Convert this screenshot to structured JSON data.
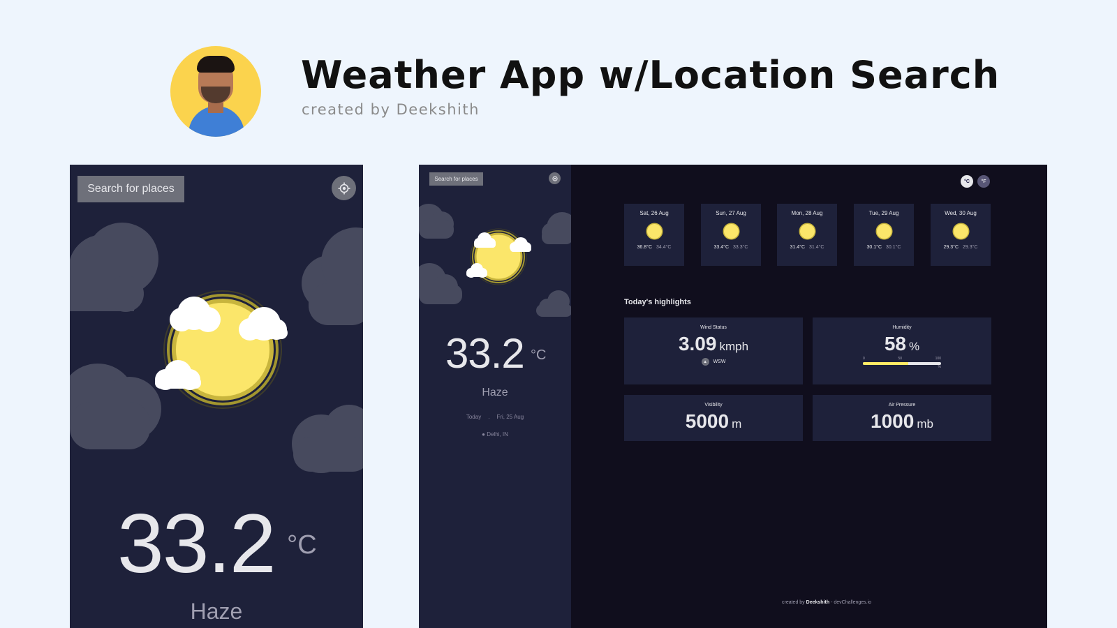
{
  "header": {
    "title": "Weather App w/Location Search",
    "subtitle": "created by Deekshith"
  },
  "mobile": {
    "search_label": "Search for places",
    "temperature": "33.2",
    "unit": "°C",
    "condition": "Haze"
  },
  "desktop": {
    "search_label": "Search for places",
    "temperature": "33.2",
    "unit": "°C",
    "condition": "Haze",
    "today_label": "Today",
    "date_sep": ".",
    "date": "Fri, 25 Aug",
    "location": "Delhi, IN",
    "unit_c": "°C",
    "unit_f": "°F",
    "forecast": [
      {
        "day": "Sat, 26 Aug",
        "max": "36.8°C",
        "min": "34.4°C"
      },
      {
        "day": "Sun, 27 Aug",
        "max": "33.4°C",
        "min": "33.3°C"
      },
      {
        "day": "Mon, 28 Aug",
        "max": "31.4°C",
        "min": "31.4°C"
      },
      {
        "day": "Tue, 29 Aug",
        "max": "30.1°C",
        "min": "30.1°C"
      },
      {
        "day": "Wed, 30 Aug",
        "max": "29.3°C",
        "min": "29.3°C"
      }
    ],
    "highlights_title": "Today's highlights",
    "wind": {
      "label": "Wind Status",
      "value": "3.09",
      "unit": "kmph",
      "direction": "WSW"
    },
    "humidity": {
      "label": "Humidity",
      "value": "58",
      "unit": "%",
      "tick_0": "0",
      "tick_50": "50",
      "tick_100": "100",
      "pct": "%",
      "level": 0.58
    },
    "visibility": {
      "label": "Visibility",
      "value": "5000",
      "unit": "m"
    },
    "pressure": {
      "label": "Air Pressure",
      "value": "1000",
      "unit": "mb"
    },
    "footer_prefix": "created by",
    "footer_name": "Deekshith",
    "footer_suffix": "- devChallenges.io"
  },
  "colors": {
    "background": "#eef5fd",
    "panel": "#1e213a",
    "dark": "#100e1d",
    "sun": "#fbe66a",
    "cloud": "#474a5e"
  }
}
